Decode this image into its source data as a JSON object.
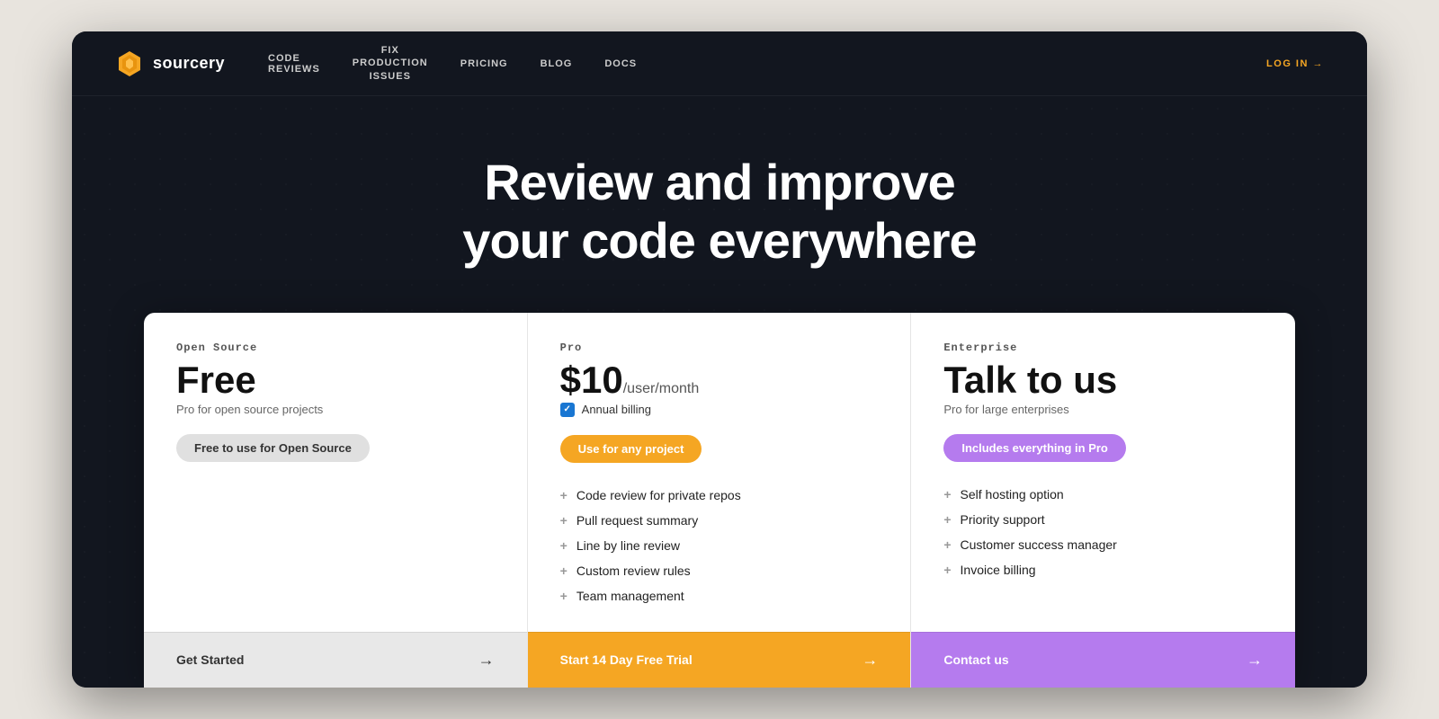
{
  "nav": {
    "logo_text": "sourcery",
    "links": [
      {
        "id": "code-reviews",
        "label": "CODE\nREVIEWS"
      },
      {
        "id": "fix-production",
        "label": "FIX\nPRODUCTION\nISSUES"
      },
      {
        "id": "pricing",
        "label": "PRICING"
      },
      {
        "id": "blog",
        "label": "BLOG"
      },
      {
        "id": "docs",
        "label": "DOCS"
      }
    ],
    "login_label": "LOG IN →"
  },
  "hero": {
    "title_line1": "Review and improve",
    "title_line2": "your code everywhere"
  },
  "pricing": {
    "plans": [
      {
        "id": "open-source",
        "tier": "Open Source",
        "price": "Free",
        "price_suffix": "",
        "subtitle": "Pro for open source projects",
        "badge": "Free to use for Open Source",
        "badge_style": "gray",
        "has_annual_billing": false,
        "features": [],
        "cta_label": "Get Started",
        "cta_style": "gray"
      },
      {
        "id": "pro",
        "tier": "Pro",
        "price": "$10",
        "price_suffix": "/user/month",
        "subtitle": "",
        "badge": "Use for any project",
        "badge_style": "orange",
        "has_annual_billing": true,
        "annual_billing_label": "Annual billing",
        "features": [
          "Code review for private repos",
          "Pull request summary",
          "Line by line review",
          "Custom review rules",
          "Team management"
        ],
        "cta_label": "Start 14 Day Free Trial",
        "cta_style": "orange"
      },
      {
        "id": "enterprise",
        "tier": "Enterprise",
        "price": "Talk to us",
        "price_suffix": "",
        "subtitle": "Pro for large enterprises",
        "badge": "Includes everything in Pro",
        "badge_style": "purple",
        "has_annual_billing": false,
        "features": [
          "Self hosting option",
          "Priority support",
          "Customer success manager",
          "Invoice billing"
        ],
        "cta_label": "Contact us",
        "cta_style": "purple"
      }
    ]
  }
}
